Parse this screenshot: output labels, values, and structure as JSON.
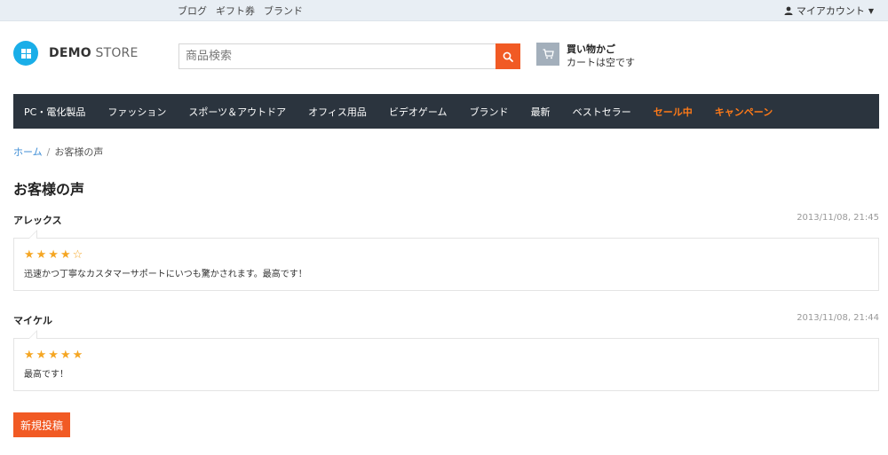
{
  "top_links": [
    "ブログ",
    "ギフト券",
    "ブランド"
  ],
  "account": {
    "label": "マイアカウント",
    "icon": "user-icon"
  },
  "logo": {
    "strong": "DEMO",
    "light": "STORE"
  },
  "search": {
    "placeholder": "商品検索",
    "icon": "search-icon"
  },
  "cart": {
    "title": "買い物かご",
    "status": "カートは空です",
    "icon": "cart-icon"
  },
  "nav": {
    "items": [
      "PC・電化製品",
      "ファッション",
      "スポーツ＆アウトドア",
      "オフィス用品",
      "ビデオゲーム",
      "ブランド",
      "最新",
      "ベストセラー"
    ],
    "highlight_items": [
      "セール中",
      "キャンペーン"
    ],
    "highlight_color": "#ff7a18"
  },
  "breadcrumb": {
    "home": "ホーム",
    "separator": "/",
    "current": "お客様の声"
  },
  "page_title": "お客様の声",
  "reviews": [
    {
      "author": "アレックス",
      "date": "2013/11/08, 21:45",
      "stars": "★★★★☆",
      "rating": 4,
      "comment": "迅速かつ丁寧なカスタマーサポートにいつも驚かされます。最高です！"
    },
    {
      "author": "マイケル",
      "date": "2013/11/08, 21:44",
      "stars": "★★★★★",
      "rating": 5,
      "comment": "最高です！"
    }
  ],
  "post_button": "新規投稿",
  "colors": {
    "accent": "#f15a24",
    "nav_bg": "#2b343e",
    "topbar_bg": "#e8eef4",
    "link": "#3f8ed6",
    "star": "#f5a623",
    "logo": "#1aaee8"
  }
}
